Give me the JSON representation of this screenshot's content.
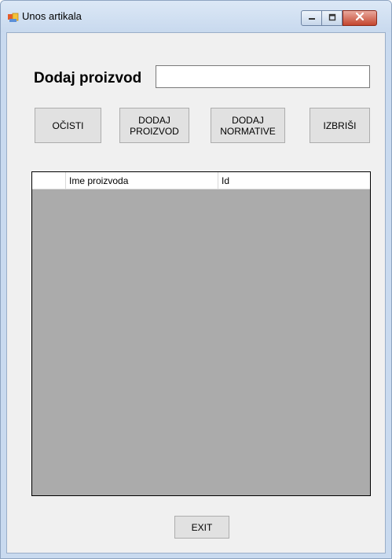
{
  "window": {
    "title": "Unos artikala",
    "icons": {
      "app": "app-form-icon",
      "minimize": "minimize-icon",
      "maximize": "maximize-icon",
      "close": "close-icon"
    },
    "colors": {
      "frame": "#c9daef",
      "client": "#f0f0f0",
      "close_button": "#c4462f"
    }
  },
  "form": {
    "product_label": "Dodaj proizvod",
    "product_input_value": "",
    "buttons": {
      "clear": "OČISTI",
      "add_product": "DODAJ\nPROIZVOD",
      "add_norms": "DODAJ\nNORMATIVE",
      "delete": "IZBRIŠI",
      "exit": "EXIT"
    }
  },
  "grid": {
    "columns": [
      "",
      "Ime proizvoda",
      "Id"
    ],
    "rows": [],
    "background_color": "#ababab"
  }
}
